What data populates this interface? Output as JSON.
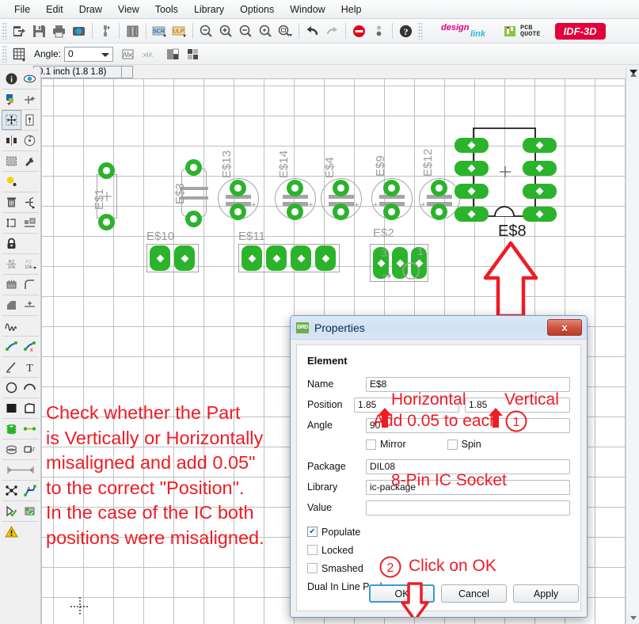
{
  "window": {
    "coordinate_display": "0.1 inch (1.8 1.8)"
  },
  "menubar": {
    "items": [
      {
        "label": "File"
      },
      {
        "label": "Edit"
      },
      {
        "label": "Draw"
      },
      {
        "label": "View"
      },
      {
        "label": "Tools"
      },
      {
        "label": "Library"
      },
      {
        "label": "Options"
      },
      {
        "label": "Window"
      },
      {
        "label": "Help"
      }
    ]
  },
  "toolbar": {
    "items": [
      {
        "icon": "open-export-icon"
      },
      {
        "icon": "save-icon"
      },
      {
        "icon": "print-icon"
      },
      {
        "icon": "cam-processor-icon"
      },
      {
        "icon": "board-schematic-switch-icon"
      },
      {
        "icon": "library-icon"
      },
      {
        "icon": "script-icon"
      },
      {
        "icon": "ulp-icon"
      },
      {
        "icon": "zoom-fit-icon"
      },
      {
        "icon": "zoom-in-icon"
      },
      {
        "icon": "zoom-out-icon"
      },
      {
        "icon": "zoom-redraw-icon"
      },
      {
        "icon": "zoom-select-icon"
      },
      {
        "icon": "undo-icon"
      },
      {
        "icon": "redo-icon"
      },
      {
        "icon": "stop-icon"
      },
      {
        "icon": "drill-icon"
      },
      {
        "icon": "help-icon"
      }
    ],
    "brand_designlink": "design link",
    "brand_pcbquote": "PCB QUOTE",
    "brand_idf3d": "IDF-3D"
  },
  "toolbar2": {
    "grid_icon": "grid-icon",
    "angle_label": "Angle:",
    "angle_value": "0",
    "text_icon": "abc-text-icon",
    "text_mirror_icon": "abc-mirror-icon",
    "layers_icon": "layers-icon",
    "layers2_icon": "layers-alt-icon"
  },
  "left_palette": {
    "items": [
      {
        "icon": "info-icon"
      },
      {
        "icon": "show-icon"
      },
      {
        "icon": "display-layers-icon"
      },
      {
        "icon": "mark-icon"
      },
      {
        "icon": "move-icon"
      },
      {
        "icon": "copy-icon"
      },
      {
        "icon": "mirror-icon"
      },
      {
        "icon": "rotate-icon"
      },
      {
        "icon": "group-icon"
      },
      {
        "icon": "change-icon"
      },
      {
        "icon": "paste-icon"
      },
      {
        "icon": "delete-icon"
      },
      {
        "icon": "add-part-icon"
      },
      {
        "icon": "pinswap-icon"
      },
      {
        "icon": "replace-icon"
      },
      {
        "icon": "lock-icon"
      },
      {
        "icon": "name-icon"
      },
      {
        "icon": "value-icon"
      },
      {
        "icon": "smash-icon"
      },
      {
        "icon": "miter-icon"
      },
      {
        "icon": "split-icon"
      },
      {
        "icon": "optimize-icon"
      },
      {
        "icon": "route-icon"
      },
      {
        "icon": "ripup-icon"
      },
      {
        "icon": "ripup-all-icon"
      },
      {
        "icon": "wire-icon"
      },
      {
        "icon": "text-icon"
      },
      {
        "icon": "circle-icon"
      },
      {
        "icon": "arc-icon"
      },
      {
        "icon": "rect-icon"
      },
      {
        "icon": "polygon-icon"
      },
      {
        "icon": "via-icon"
      },
      {
        "icon": "signal-icon"
      },
      {
        "icon": "hole-icon"
      },
      {
        "icon": "attribute-icon"
      },
      {
        "icon": "dimension-icon"
      },
      {
        "icon": "ratsnest-icon"
      },
      {
        "icon": "autorouter-icon"
      },
      {
        "icon": "drc-icon"
      },
      {
        "icon": "erc-icon"
      },
      {
        "icon": "errors-icon"
      }
    ]
  },
  "canvas": {
    "parts": [
      {
        "name": "E$1",
        "type": "resistor"
      },
      {
        "name": "E$3",
        "type": "capacitor-axial"
      },
      {
        "name": "E$13",
        "type": "capacitor-radial"
      },
      {
        "name": "E$14",
        "type": "capacitor-radial"
      },
      {
        "name": "E$4",
        "type": "capacitor-radial"
      },
      {
        "name": "E$9",
        "type": "capacitor-radial"
      },
      {
        "name": "E$12",
        "type": "capacitor-radial"
      },
      {
        "name": "E$10",
        "type": "header-2pin"
      },
      {
        "name": "E$11",
        "type": "header-4pin"
      },
      {
        "name": "E$2",
        "type": "transistor-3pin"
      },
      {
        "name": "E$8",
        "type": "dil08-ic"
      }
    ],
    "selected_part_label": "E$8"
  },
  "annotations": {
    "note_lines": [
      "Check whether the Part",
      "is Vertically or Horizontally",
      "misaligned and add 0.05\"",
      "to the correct \"Position\".",
      "In the case of the IC both",
      "positions were misaligned."
    ],
    "horizontal_label": "Horizontal",
    "vertical_label": "Vertical",
    "add_label": "Add 0.05 to each",
    "step1": "1",
    "step2": "2",
    "click_ok_label": "Click on OK",
    "package_label": "8-Pin IC Socket",
    "color": "#ee1c25"
  },
  "dialog": {
    "title": "Properties",
    "close_label": "x",
    "group_title": "Element",
    "fields": {
      "name_label": "Name",
      "name_value": "E$8",
      "position_label": "Position",
      "position_x": "1.85",
      "position_y": "1.85",
      "angle_label": "Angle",
      "angle_value": "90",
      "mirror_label": "Mirror",
      "spin_label": "Spin",
      "package_label": "Package",
      "package_value": "DIL08",
      "library_label": "Library",
      "library_value": "ic-package",
      "value_label": "Value",
      "value_value": "",
      "populate_label": "Populate",
      "locked_label": "Locked",
      "smashed_label": "Smashed",
      "description": "Dual In Line Package"
    },
    "checkboxes": {
      "mirror": false,
      "spin": false,
      "populate": true,
      "locked": false,
      "smashed": false
    },
    "buttons": {
      "ok": "OK",
      "cancel": "Cancel",
      "apply": "Apply"
    }
  }
}
